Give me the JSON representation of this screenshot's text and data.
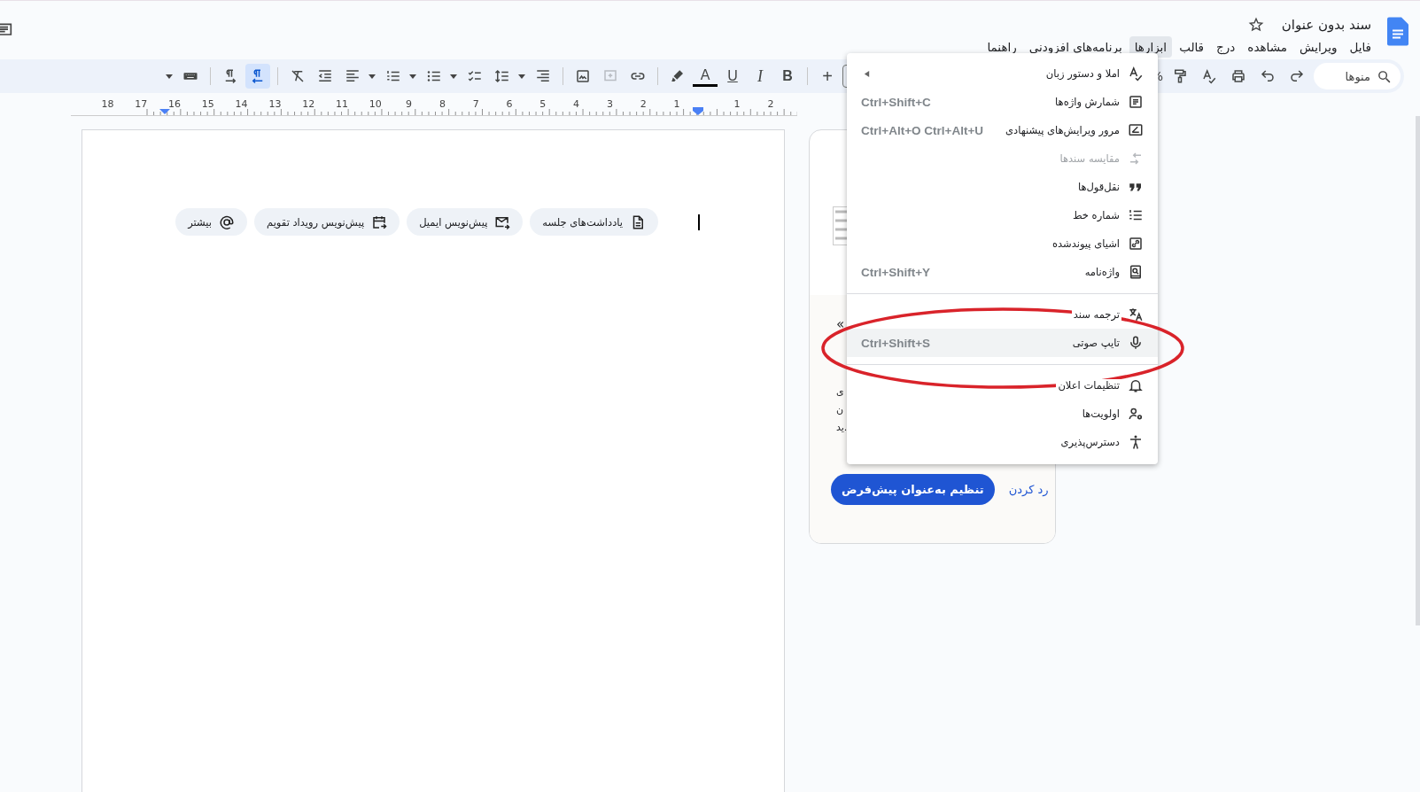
{
  "header": {
    "title": "سند بدون عنوان",
    "starred": false,
    "menus": [
      {
        "label": "فایل",
        "selected": false
      },
      {
        "label": "ویرایش",
        "selected": false
      },
      {
        "label": "مشاهده",
        "selected": false
      },
      {
        "label": "درج",
        "selected": false
      },
      {
        "label": "قالب",
        "selected": false
      },
      {
        "label": "ابزارها",
        "selected": true
      },
      {
        "label": "برنامه‌های افزودنی",
        "selected": false
      },
      {
        "label": "راهنما",
        "selected": false
      }
    ]
  },
  "toolbar": {
    "search": {
      "placeholder": "منوها"
    },
    "right_tools": [
      {
        "kind": "redo"
      },
      {
        "kind": "undo"
      },
      {
        "kind": "print"
      },
      {
        "kind": "spellcheck"
      },
      {
        "kind": "paint-format"
      }
    ],
    "zoom_fragment": "%",
    "left_tools": [
      {
        "kind": "font-size-box"
      },
      {
        "kind": "plus",
        "glyph": "+"
      },
      {
        "kind": "divider"
      },
      {
        "kind": "bold",
        "glyph": "B"
      },
      {
        "kind": "italic",
        "glyph": "I"
      },
      {
        "kind": "underline",
        "glyph": "U"
      },
      {
        "kind": "text-color",
        "glyph": "A"
      },
      {
        "kind": "highlight"
      },
      {
        "kind": "divider"
      },
      {
        "kind": "link"
      },
      {
        "kind": "add-comment",
        "disabled": true
      },
      {
        "kind": "image"
      },
      {
        "kind": "divider"
      },
      {
        "kind": "align-right"
      },
      {
        "kind": "caret"
      },
      {
        "kind": "line-spacing"
      },
      {
        "kind": "checklist"
      },
      {
        "kind": "caret"
      },
      {
        "kind": "bullet-list"
      },
      {
        "kind": "caret"
      },
      {
        "kind": "numbered-list"
      },
      {
        "kind": "caret"
      },
      {
        "kind": "align"
      },
      {
        "kind": "indent-less"
      },
      {
        "kind": "clear-format"
      },
      {
        "kind": "divider"
      },
      {
        "kind": "rtl",
        "selected": true
      },
      {
        "kind": "ltr",
        "selected": false
      },
      {
        "kind": "divider"
      },
      {
        "kind": "keyboard"
      },
      {
        "kind": "caret"
      }
    ]
  },
  "ruler": {
    "right_labels": [
      "2",
      "1"
    ],
    "left_labels": [
      "1",
      "2",
      "3",
      "4",
      "5",
      "6",
      "7",
      "8",
      "9",
      "10",
      "11",
      "12",
      "13",
      "14",
      "15",
      "16",
      "17",
      "18"
    ]
  },
  "document": {
    "chips": [
      {
        "kind": "notes",
        "label": "یادداشت‌های جلسه"
      },
      {
        "kind": "email",
        "label": "پیش‌نویس ایمیل"
      },
      {
        "kind": "calendar",
        "label": "پیش‌نویس رویداد تقویم"
      },
      {
        "kind": "more",
        "label": "بیشتر"
      }
    ]
  },
  "card": {
    "quote_fragment": "«",
    "text_fragments": [
      "ی",
      "ن",
      "ید."
    ],
    "primary_button": "تنظیم به‌عنوان پیش‌فرض",
    "secondary_button": "رد کردن"
  },
  "menu": {
    "groups": [
      [
        {
          "kind": "spelling",
          "label": "املا و دستور زبان",
          "has_submenu": true,
          "disabled": false,
          "selected": false
        },
        {
          "kind": "word-count",
          "label": "شمارش واژه‌ها",
          "shortcut": "Ctrl+Shift+C",
          "has_submenu": false,
          "disabled": false,
          "selected": false
        },
        {
          "kind": "review",
          "label": "مرور ویرایش‌های پیشنهادی",
          "shortcut": "Ctrl+Alt+O Ctrl+Alt+U",
          "has_submenu": false,
          "disabled": false,
          "selected": false
        },
        {
          "kind": "compare",
          "label": "مقایسه سندها",
          "has_submenu": false,
          "disabled": true,
          "selected": false
        },
        {
          "kind": "citations",
          "label": "نقل‌قول‌ها",
          "has_submenu": false,
          "disabled": false,
          "selected": false
        },
        {
          "kind": "line-numbers",
          "label": "شماره خط",
          "has_submenu": false,
          "disabled": false,
          "selected": false
        },
        {
          "kind": "linked",
          "label": "اشیای پیوندشده",
          "has_submenu": false,
          "disabled": false,
          "selected": false
        },
        {
          "kind": "dictionary",
          "label": "واژه‌نامه",
          "shortcut": "Ctrl+Shift+Y",
          "has_submenu": false,
          "disabled": false,
          "selected": false
        }
      ],
      [
        {
          "kind": "translate",
          "label": "ترجمه سند",
          "has_submenu": false,
          "disabled": false,
          "selected": false
        },
        {
          "kind": "voice",
          "label": "تایپ صوتی",
          "shortcut": "Ctrl+Shift+S",
          "has_submenu": false,
          "disabled": false,
          "selected": true
        }
      ],
      [
        {
          "kind": "notifications",
          "label": "تنظیمات اعلان",
          "has_submenu": false,
          "disabled": false,
          "selected": false
        },
        {
          "kind": "preferences",
          "label": "اولویت‌ها",
          "has_submenu": false,
          "disabled": false,
          "selected": false
        },
        {
          "kind": "accessibility",
          "label": "دسترس‌پذیری",
          "has_submenu": false,
          "disabled": false,
          "selected": false
        }
      ]
    ]
  },
  "annotation": {
    "kind": "ellipse"
  }
}
